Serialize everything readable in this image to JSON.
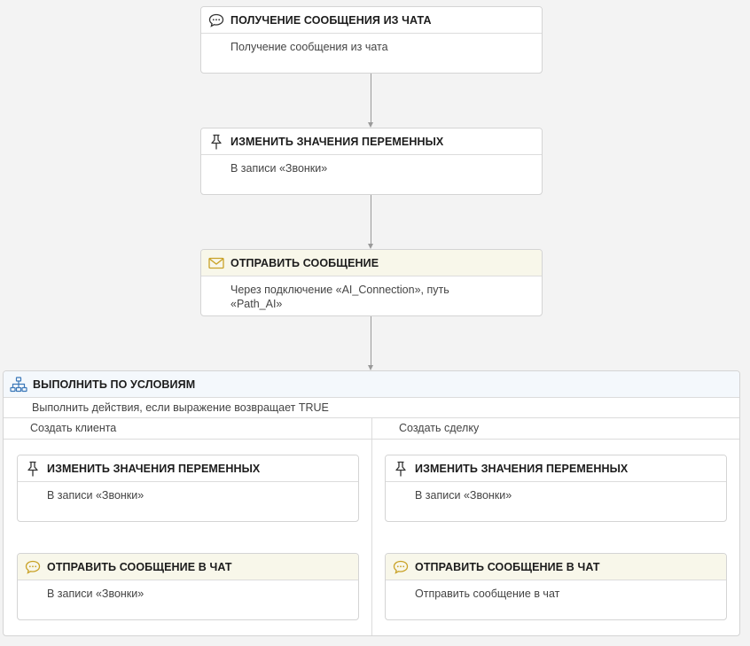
{
  "flow": {
    "step1": {
      "icon": "chat-bubble-icon",
      "title": "ПОЛУЧЕНИЕ СООБЩЕНИЯ ИЗ ЧАТА",
      "description": "Получение сообщения из чата"
    },
    "step2": {
      "icon": "pin-icon",
      "title": "ИЗМЕНИТЬ ЗНАЧЕНИЯ ПЕРЕМЕННЫХ",
      "description": "В записи «Звонки»"
    },
    "step3": {
      "icon": "envelope-icon",
      "title": "ОТПРАВИТЬ СООБЩЕНИЕ",
      "description": "Через подключение «AI_Connection», путь «Path_AI»"
    },
    "condition": {
      "icon": "hierarchy-icon",
      "title": "ВЫПОЛНИТЬ ПО УСЛОВИЯМ",
      "description": "Выполнить действия, если выражение возвращает TRUE",
      "branches": [
        {
          "label": "Создать клиента",
          "steps": [
            {
              "icon": "pin-icon",
              "title": "ИЗМЕНИТЬ ЗНАЧЕНИЯ ПЕРЕМЕННЫХ",
              "description": "В записи «Звонки»"
            },
            {
              "icon": "chat-bubble-icon",
              "title": "ОТПРАВИТЬ СООБЩЕНИЕ В ЧАТ",
              "description": "В записи «Звонки»"
            }
          ]
        },
        {
          "label": "Создать сделку",
          "steps": [
            {
              "icon": "pin-icon",
              "title": "ИЗМЕНИТЬ ЗНАЧЕНИЯ ПЕРЕМЕННЫХ",
              "description": "В записи «Звонки»"
            },
            {
              "icon": "chat-bubble-icon",
              "title": "ОТПРАВИТЬ СООБЩЕНИЕ В ЧАТ",
              "description": "Отправить сообщение в чат"
            }
          ]
        }
      ]
    }
  },
  "colors": {
    "background": "#f3f3f3",
    "card_border": "#d4d4d4",
    "highlight_header": "#f8f7ea",
    "condition_header": "#f4f8fc",
    "accent_gold": "#c9a227",
    "accent_blue": "#3b78b8",
    "connector": "#9a9a9a"
  }
}
